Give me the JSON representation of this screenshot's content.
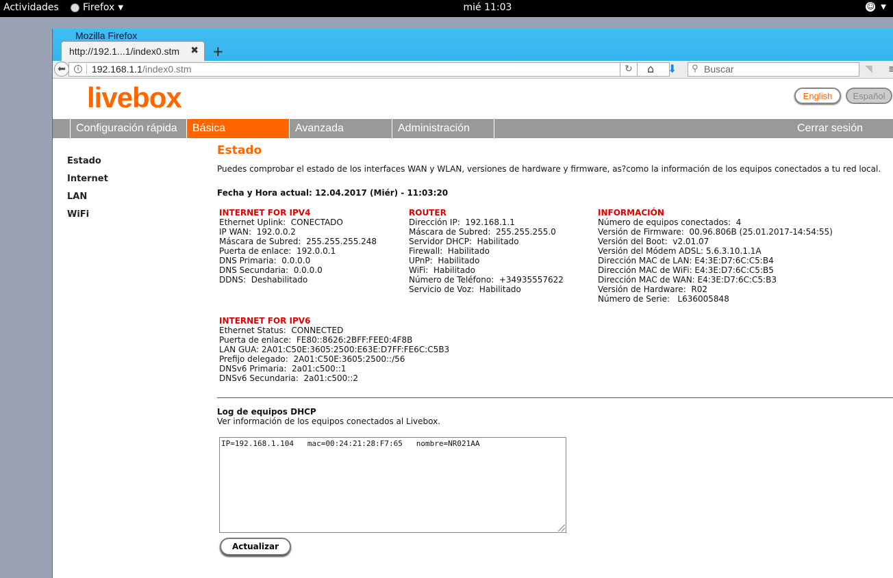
{
  "topbar": {
    "activities": "Actividades",
    "app_name": "Firefox",
    "clock": "mié 11:03"
  },
  "window": {
    "title": "Mozilla Firefox",
    "tab_label": "http://192.1...1/index0.stm",
    "url_host": "192.168.1.1",
    "url_path": "/index0.stm",
    "search_placeholder": "Buscar"
  },
  "header": {
    "logo": "livebox",
    "lang_english": "English",
    "lang_spanish": "Español"
  },
  "nav": {
    "items": [
      "Configuración rápida",
      "Básica",
      "Avanzada",
      "Administración"
    ],
    "active": "Básica",
    "logout": "Cerrar sesión"
  },
  "sidebar": {
    "items": [
      "Estado",
      "Internet",
      "LAN",
      "WiFi"
    ]
  },
  "main": {
    "title": "Estado",
    "description": "Puedes comprobar el estado de los interfaces WAN y WLAN, versiones de hardware y firmware, as?como la información de los equipos conectados a tu red local.",
    "datetime": "Fecha y Hora actual: 12.04.2017 (Miér) - 11:03:20"
  },
  "ipv4": {
    "heading": "INTERNET FOR IPV4",
    "rows": [
      "Ethernet Uplink:  CONECTADO",
      "IP WAN:  192.0.0.2",
      "Máscara de Subred:  255.255.255.248",
      "Puerta de enlace:  192.0.0.1",
      "DNS Primaria:  0.0.0.0",
      "DNS Secundaria:  0.0.0.0",
      "DDNS:  Deshabilitado"
    ]
  },
  "router": {
    "heading": "ROUTER",
    "rows": [
      "Dirección IP:  192.168.1.1",
      "Máscara de Subred:  255.255.255.0",
      "Servidor DHCP:  Habilitado",
      "Firewall:  Habilitado",
      "UPnP:  Habilitado",
      "WiFi:  Habilitado",
      "Número de Teléfono:  +34935557622",
      "Servicio de Voz:  Habilitado"
    ]
  },
  "info": {
    "heading": "INFORMACIÓN",
    "rows": [
      "Número de equipos conectados:  4",
      "Versión de Firmware:  00.96.806B (25.01.2017-14:54:55)",
      "Versión del Boot:  v2.01.07",
      "Versión del Módem ADSL: 5.6.3.10.1.1A",
      "Dirección MAC de LAN: E4:3E:D7:6C:C5:B4",
      "Dirección MAC de WiFi: E4:3E:D7:6C:C5:B5",
      "Dirección MAC de WAN: E4:3E:D7:6C:C5:B3",
      "Versión de Hardware:  R02",
      "Número de Serie:   L636005848"
    ]
  },
  "ipv6": {
    "heading": "INTERNET FOR IPV6",
    "rows": [
      "Ethernet Status:  CONNECTED",
      "Puerta de enlace:  FE80::8626:2BFF:FEE0:4F8B",
      "LAN GUA: 2A01:C50E:3605:2500:E63E:D7FF:FE6C:C5B3",
      "Prefijo delegado:  2A01:C50E:3605:2500::/56",
      "DNSv6 Primaria:  2a01:c500::1",
      "DNSv6 Secundaria:  2a01:c500::2"
    ]
  },
  "dhcp": {
    "title": "Log de equipos DHCP",
    "description": "Ver información de los equipos conectados al Livebox.",
    "log": "IP=192.168.1.104   mac=00:24:21:28:F7:65   nombre=NR021AA",
    "refresh_label": "Actualizar"
  }
}
